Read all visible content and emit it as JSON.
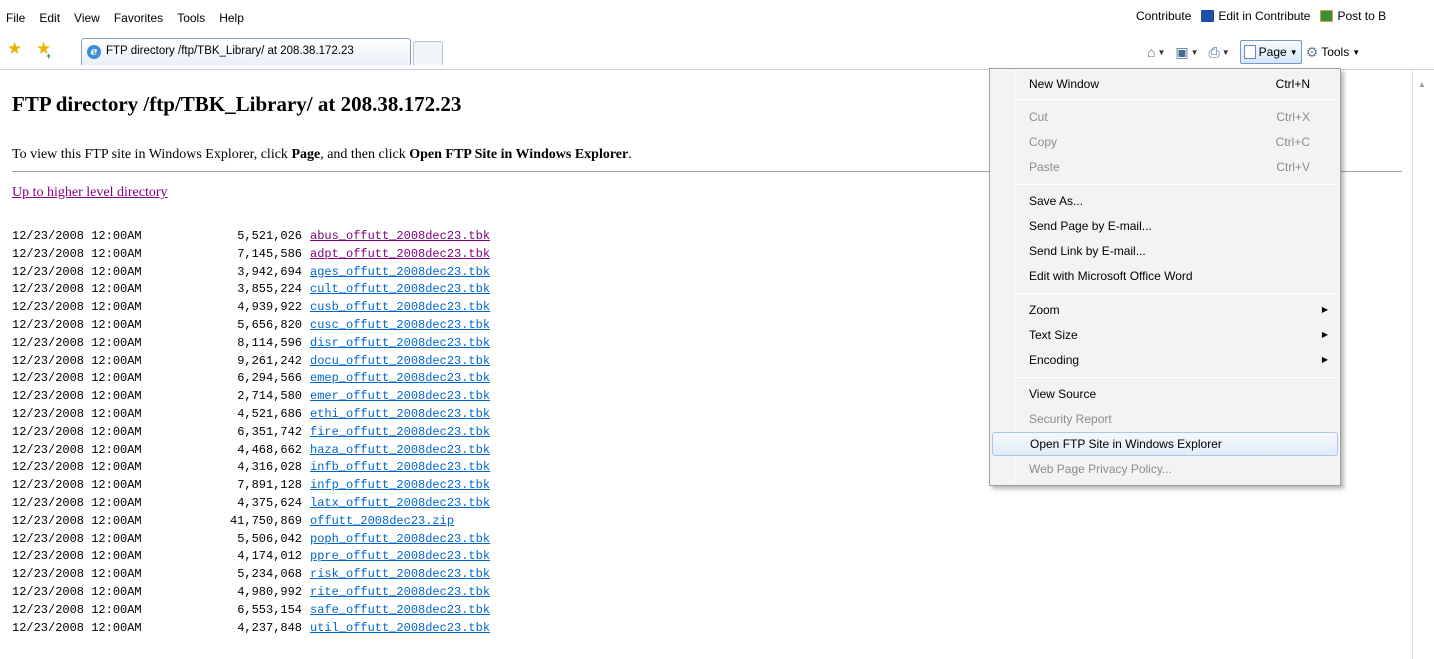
{
  "menubar": {
    "items": [
      "File",
      "Edit",
      "View",
      "Favorites",
      "Tools",
      "Help"
    ],
    "contribute": "Contribute",
    "edit_in_contribute": "Edit in Contribute",
    "post_to": "Post to B"
  },
  "tab": {
    "title": "FTP directory /ftp/TBK_Library/ at 208.38.172.23"
  },
  "command_bar": {
    "page_label": "Page",
    "tools_label": "Tools"
  },
  "page": {
    "title": "FTP directory /ftp/TBK_Library/ at 208.38.172.23",
    "instruction_pre": "To view this FTP site in Windows Explorer, click ",
    "instruction_bold1": "Page",
    "instruction_mid": ", and then click ",
    "instruction_bold2": "Open FTP Site in Windows Explorer",
    "instruction_post": ".",
    "up_link": "Up to higher level directory"
  },
  "listing": [
    {
      "date": "12/23/2008 12:00AM",
      "size": "5,521,026",
      "name": "abus_offutt_2008dec23.tbk",
      "visited": true
    },
    {
      "date": "12/23/2008 12:00AM",
      "size": "7,145,586",
      "name": "adpt_offutt_2008dec23.tbk",
      "visited": true
    },
    {
      "date": "12/23/2008 12:00AM",
      "size": "3,942,694",
      "name": "ages_offutt_2008dec23.tbk",
      "visited": false
    },
    {
      "date": "12/23/2008 12:00AM",
      "size": "3,855,224",
      "name": "cult_offutt_2008dec23.tbk",
      "visited": false
    },
    {
      "date": "12/23/2008 12:00AM",
      "size": "4,939,922",
      "name": "cusb_offutt_2008dec23.tbk",
      "visited": false
    },
    {
      "date": "12/23/2008 12:00AM",
      "size": "5,656,820",
      "name": "cusc_offutt_2008dec23.tbk",
      "visited": false
    },
    {
      "date": "12/23/2008 12:00AM",
      "size": "8,114,596",
      "name": "disr_offutt_2008dec23.tbk",
      "visited": false
    },
    {
      "date": "12/23/2008 12:00AM",
      "size": "9,261,242",
      "name": "docu_offutt_2008dec23.tbk",
      "visited": false
    },
    {
      "date": "12/23/2008 12:00AM",
      "size": "6,294,566",
      "name": "emep_offutt_2008dec23.tbk",
      "visited": false
    },
    {
      "date": "12/23/2008 12:00AM",
      "size": "2,714,580",
      "name": "emer_offutt_2008dec23.tbk",
      "visited": false
    },
    {
      "date": "12/23/2008 12:00AM",
      "size": "4,521,686",
      "name": "ethi_offutt_2008dec23.tbk",
      "visited": false
    },
    {
      "date": "12/23/2008 12:00AM",
      "size": "6,351,742",
      "name": "fire_offutt_2008dec23.tbk",
      "visited": false
    },
    {
      "date": "12/23/2008 12:00AM",
      "size": "4,468,662",
      "name": "haza_offutt_2008dec23.tbk",
      "visited": false
    },
    {
      "date": "12/23/2008 12:00AM",
      "size": "4,316,028",
      "name": "infb_offutt_2008dec23.tbk",
      "visited": false
    },
    {
      "date": "12/23/2008 12:00AM",
      "size": "7,891,128",
      "name": "infp_offutt_2008dec23.tbk",
      "visited": false
    },
    {
      "date": "12/23/2008 12:00AM",
      "size": "4,375,624",
      "name": "latx_offutt_2008dec23.tbk",
      "visited": false
    },
    {
      "date": "12/23/2008 12:00AM",
      "size": "41,750,869",
      "name": "offutt_2008dec23.zip",
      "visited": false
    },
    {
      "date": "12/23/2008 12:00AM",
      "size": "5,506,042",
      "name": "poph_offutt_2008dec23.tbk",
      "visited": false
    },
    {
      "date": "12/23/2008 12:00AM",
      "size": "4,174,012",
      "name": "ppre_offutt_2008dec23.tbk",
      "visited": false
    },
    {
      "date": "12/23/2008 12:00AM",
      "size": "5,234,068",
      "name": "risk_offutt_2008dec23.tbk",
      "visited": false
    },
    {
      "date": "12/23/2008 12:00AM",
      "size": "4,980,992",
      "name": "rite_offutt_2008dec23.tbk",
      "visited": false
    },
    {
      "date": "12/23/2008 12:00AM",
      "size": "6,553,154",
      "name": "safe_offutt_2008dec23.tbk",
      "visited": false
    },
    {
      "date": "12/23/2008 12:00AM",
      "size": "4,237,848",
      "name": "util_offutt_2008dec23.tbk",
      "visited": false
    }
  ],
  "page_menu": {
    "new_window": {
      "label": "New Window",
      "shortcut": "Ctrl+N"
    },
    "cut": {
      "label": "Cut",
      "shortcut": "Ctrl+X"
    },
    "copy": {
      "label": "Copy",
      "shortcut": "Ctrl+C"
    },
    "paste": {
      "label": "Paste",
      "shortcut": "Ctrl+V"
    },
    "save_as": "Save As...",
    "send_page": "Send Page by E-mail...",
    "send_link": "Send Link by E-mail...",
    "edit_word": "Edit with Microsoft Office Word",
    "zoom": "Zoom",
    "text_size": "Text Size",
    "encoding": "Encoding",
    "view_source": "View Source",
    "security_report": "Security Report",
    "open_ftp": "Open FTP Site in Windows Explorer",
    "privacy_policy": "Web Page Privacy Policy..."
  },
  "colors": {
    "link": "#0066cc",
    "visited_link": "#800080",
    "menu_highlight": "#e2ecf8"
  }
}
